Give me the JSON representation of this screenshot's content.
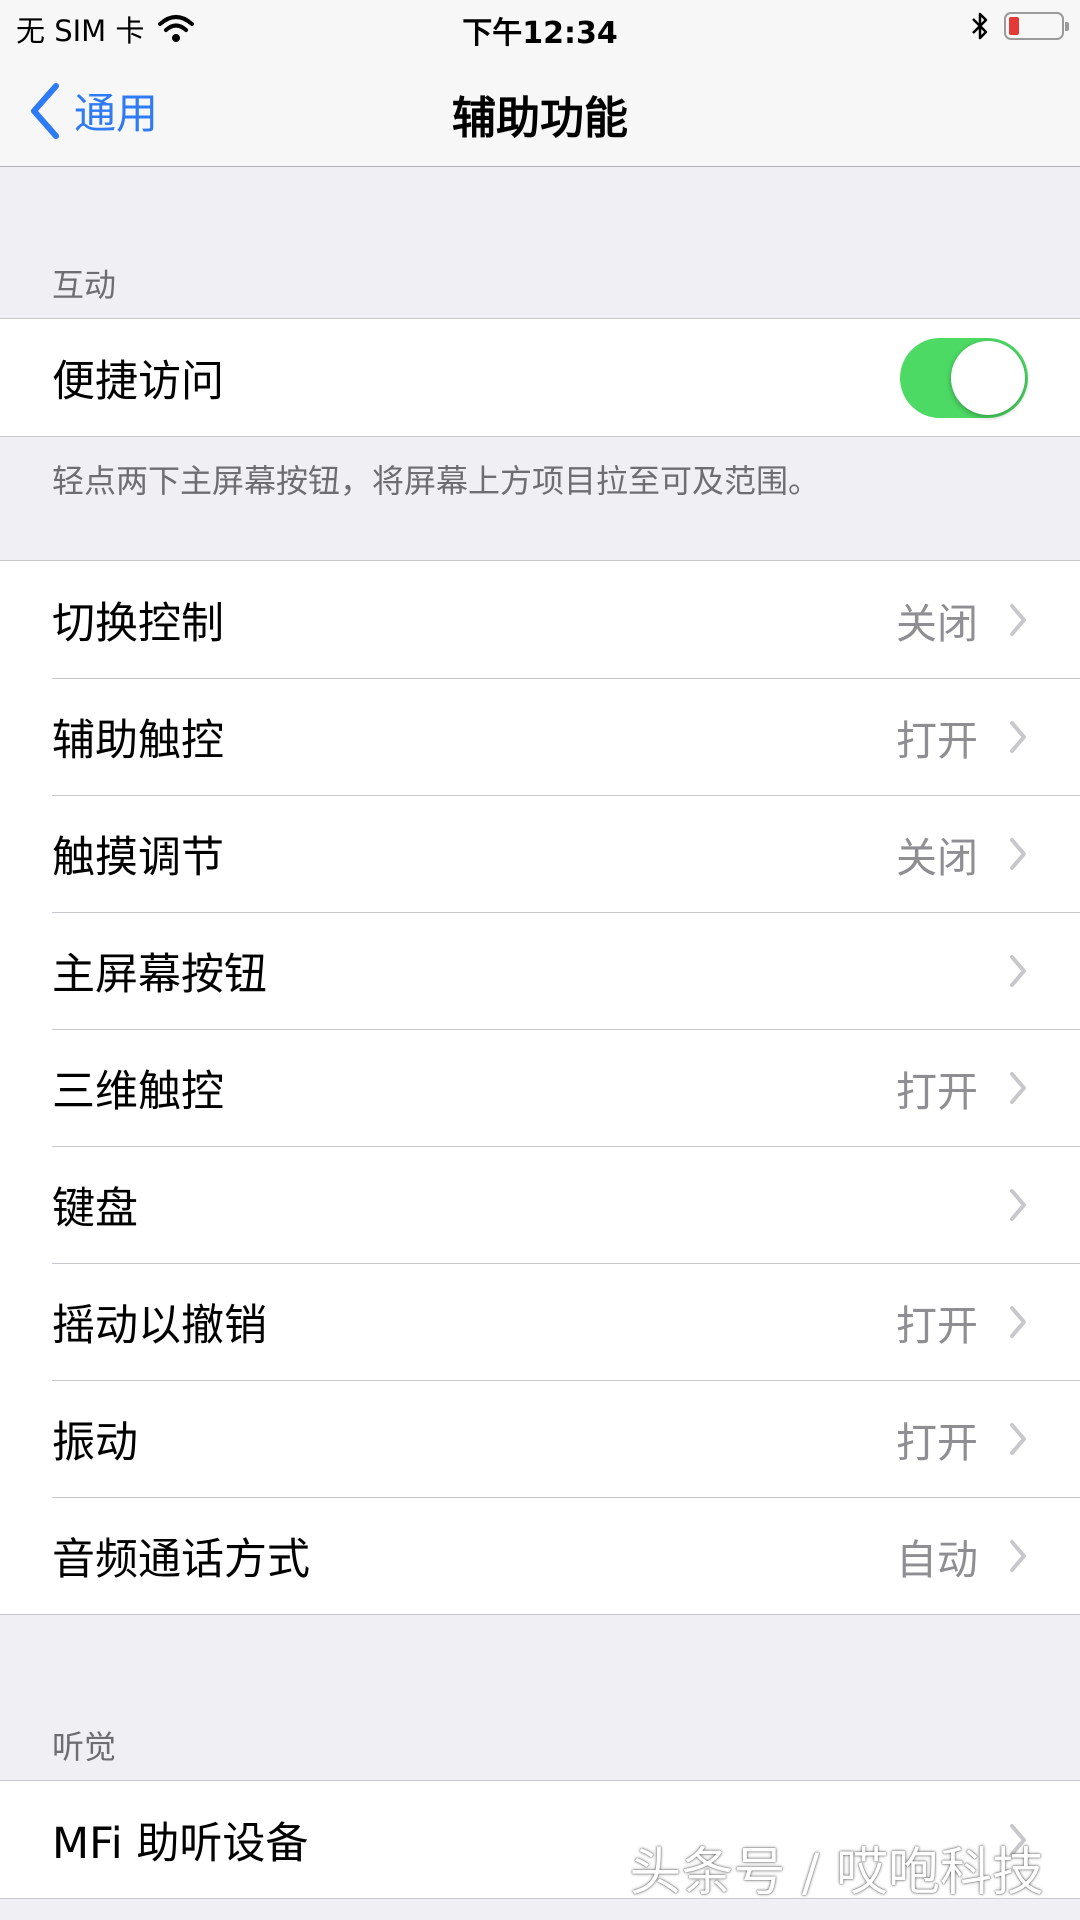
{
  "status_bar": {
    "carrier": "无 SIM 卡",
    "time": "下午12:34",
    "battery_level_fraction": 0.12,
    "battery_color": "#e53935"
  },
  "nav": {
    "back_label": "通用",
    "title": "辅助功能",
    "accent_color": "#2f7bf5"
  },
  "interaction": {
    "header": "互动",
    "reachability": {
      "label": "便捷访问",
      "toggle_on": true,
      "toggle_color": "#4cd964"
    },
    "footer": "轻点两下主屏幕按钮，将屏幕上方项目拉至可及范围。",
    "items": [
      {
        "label": "切换控制",
        "value": "关闭"
      },
      {
        "label": "辅助触控",
        "value": "打开"
      },
      {
        "label": "触摸调节",
        "value": "关闭"
      },
      {
        "label": "主屏幕按钮",
        "value": ""
      },
      {
        "label": "三维触控",
        "value": "打开"
      },
      {
        "label": "键盘",
        "value": ""
      },
      {
        "label": "摇动以撤销",
        "value": "打开"
      },
      {
        "label": "振动",
        "value": "打开"
      },
      {
        "label": "音频通话方式",
        "value": "自动"
      }
    ]
  },
  "hearing": {
    "header": "听觉",
    "items": [
      {
        "label": "MFi 助听设备",
        "value": ""
      }
    ]
  },
  "watermark": "头条号 / 哎咆科技",
  "icons": {
    "wifi": "wifi-icon",
    "bluetooth": "bluetooth-icon",
    "battery": "battery-icon",
    "back": "chevron-left-icon",
    "disclosure": "chevron-right-icon"
  }
}
